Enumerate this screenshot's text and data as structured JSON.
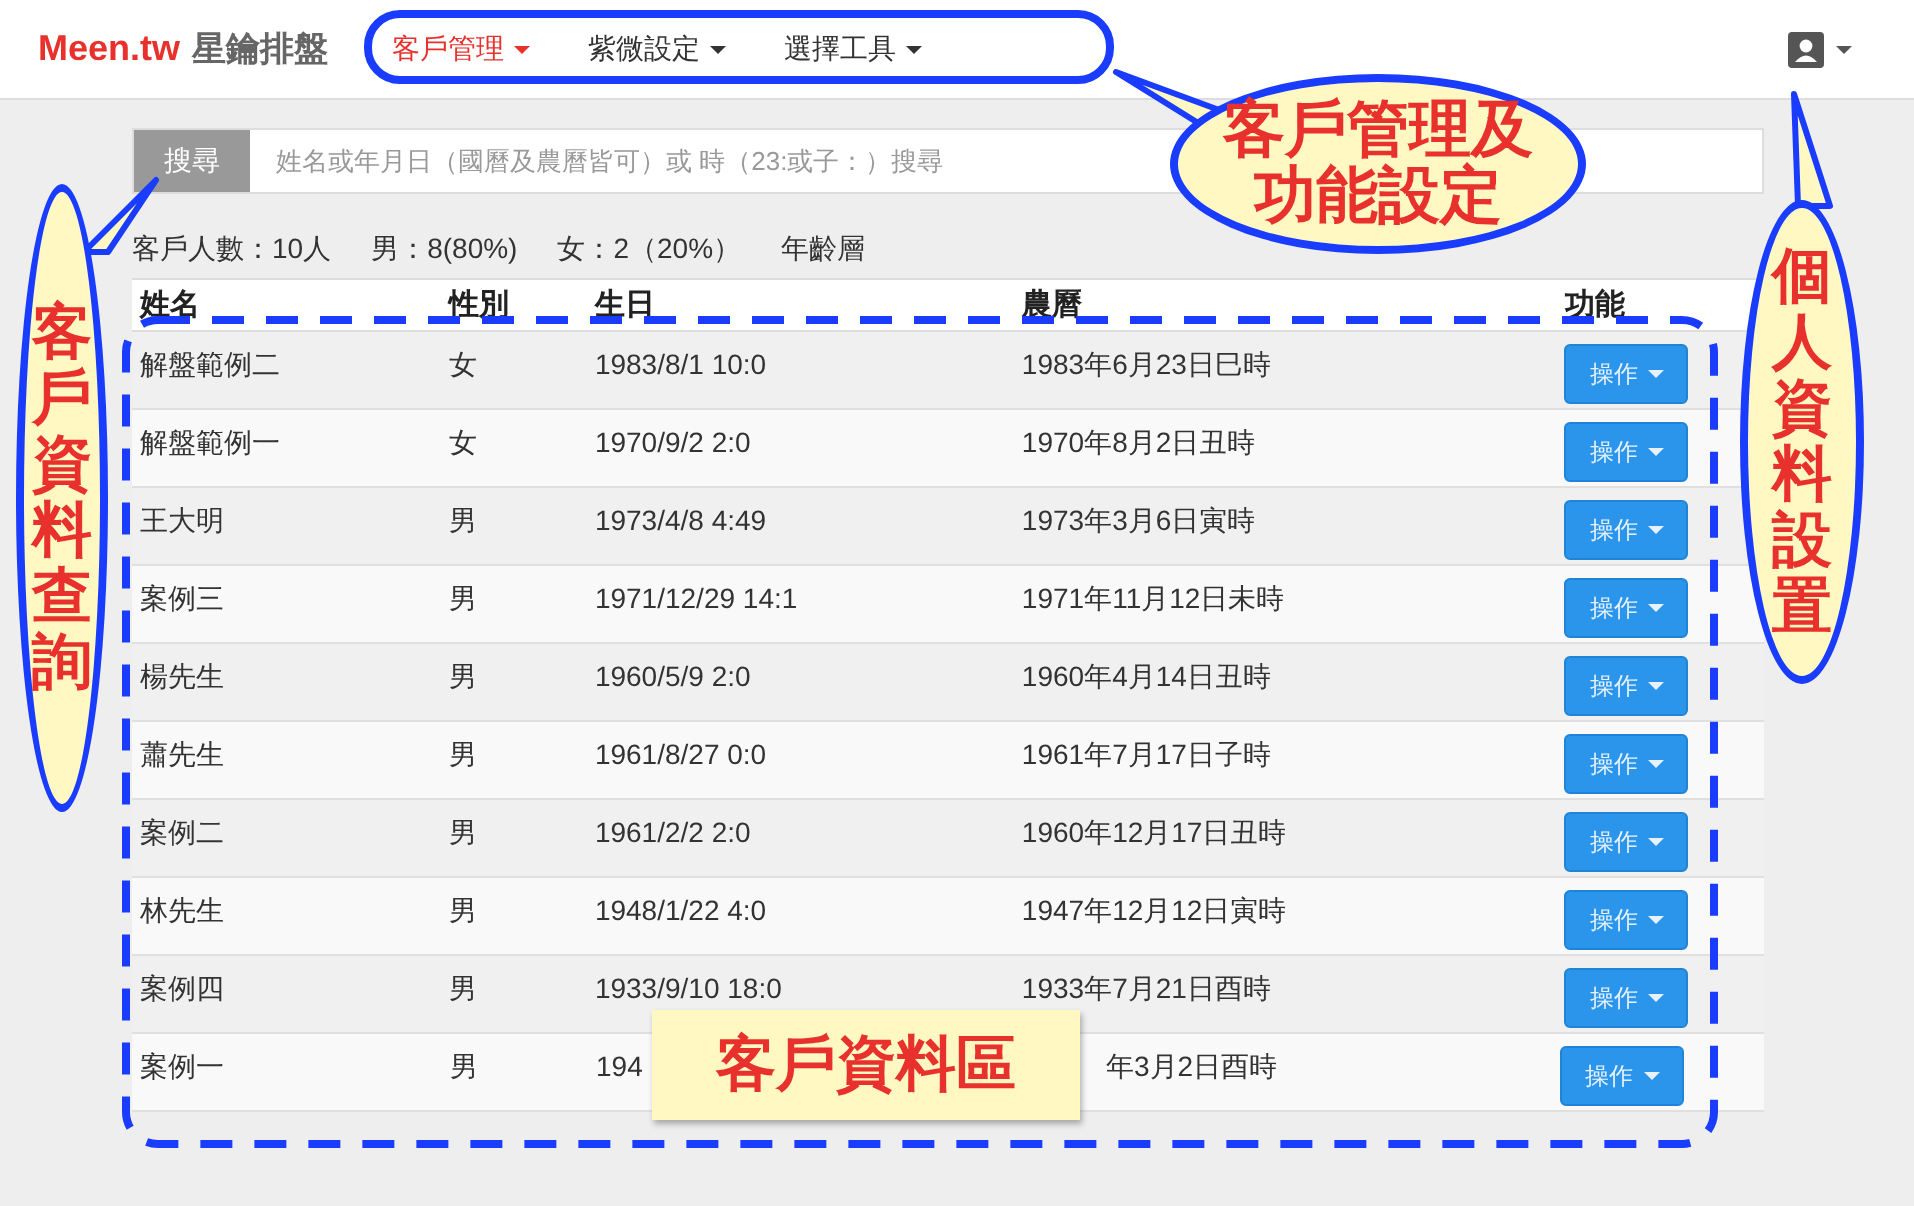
{
  "navbar": {
    "brand": "Meen.tw",
    "brand_subtitle": "星鑰排盤",
    "menus": [
      {
        "label": "客戶管理",
        "selected": true
      },
      {
        "label": "紫微設定",
        "selected": false
      },
      {
        "label": "選擇工具",
        "selected": false
      }
    ]
  },
  "search": {
    "button": "搜尋",
    "placeholder": "姓名或年月日（國曆及農曆皆可）或 時（23:或子：）搜尋"
  },
  "stats": [
    "客戶人數：10人",
    "男：8(80%)",
    "女：2（20%）",
    "年齡層"
  ],
  "table": {
    "columns": [
      "姓名",
      "性別",
      "生日",
      "農曆",
      "功能"
    ],
    "rows": [
      {
        "name": "解盤範例二",
        "gender": "女",
        "birthday": "1983/8/1 10:0",
        "lunar": "1983年6月23日巳時",
        "action": "操作",
        "covered": false
      },
      {
        "name": "解盤範例一",
        "gender": "女",
        "birthday": "1970/9/2 2:0",
        "lunar": "1970年8月2日丑時",
        "action": "操作",
        "covered": false
      },
      {
        "name": "王大明",
        "gender": "男",
        "birthday": "1973/4/8 4:49",
        "lunar": "1973年3月6日寅時",
        "action": "操作",
        "covered": false
      },
      {
        "name": "案例三",
        "gender": "男",
        "birthday": "1971/12/29 14:1",
        "lunar": "1971年11月12日未時",
        "action": "操作",
        "covered": false
      },
      {
        "name": "楊先生",
        "gender": "男",
        "birthday": "1960/5/9 2:0",
        "lunar": "1960年4月14日丑時",
        "action": "操作",
        "covered": false
      },
      {
        "name": "蕭先生",
        "gender": "男",
        "birthday": "1961/8/27 0:0",
        "lunar": "1961年7月17日子時",
        "action": "操作",
        "covered": false
      },
      {
        "name": "案例二",
        "gender": "男",
        "birthday": "1961/2/2 2:0",
        "lunar": "1960年12月17日丑時",
        "action": "操作",
        "covered": false
      },
      {
        "name": "林先生",
        "gender": "男",
        "birthday": "1948/1/22 4:0",
        "lunar": "1947年12月12日寅時",
        "action": "操作",
        "covered": false
      },
      {
        "name": "案例四",
        "gender": "男",
        "birthday": "1933/9/10 18:0",
        "lunar": "1933年7月21日酉時",
        "action": "操作",
        "covered": false
      },
      {
        "name": "案例一",
        "gender": "男",
        "birthday": "194",
        "lunar": "年3月2日酉時",
        "action": "操作",
        "covered": true
      }
    ]
  },
  "annotations": [
    {
      "kind": "bubble",
      "lines": [
        "客戶管理及",
        "功能設定"
      ]
    },
    {
      "kind": "left-oval",
      "text": "客戶資料查詢"
    },
    {
      "kind": "right-oval",
      "text": "個人資料設置"
    },
    {
      "kind": "note",
      "text": "客戶資料區"
    }
  ]
}
